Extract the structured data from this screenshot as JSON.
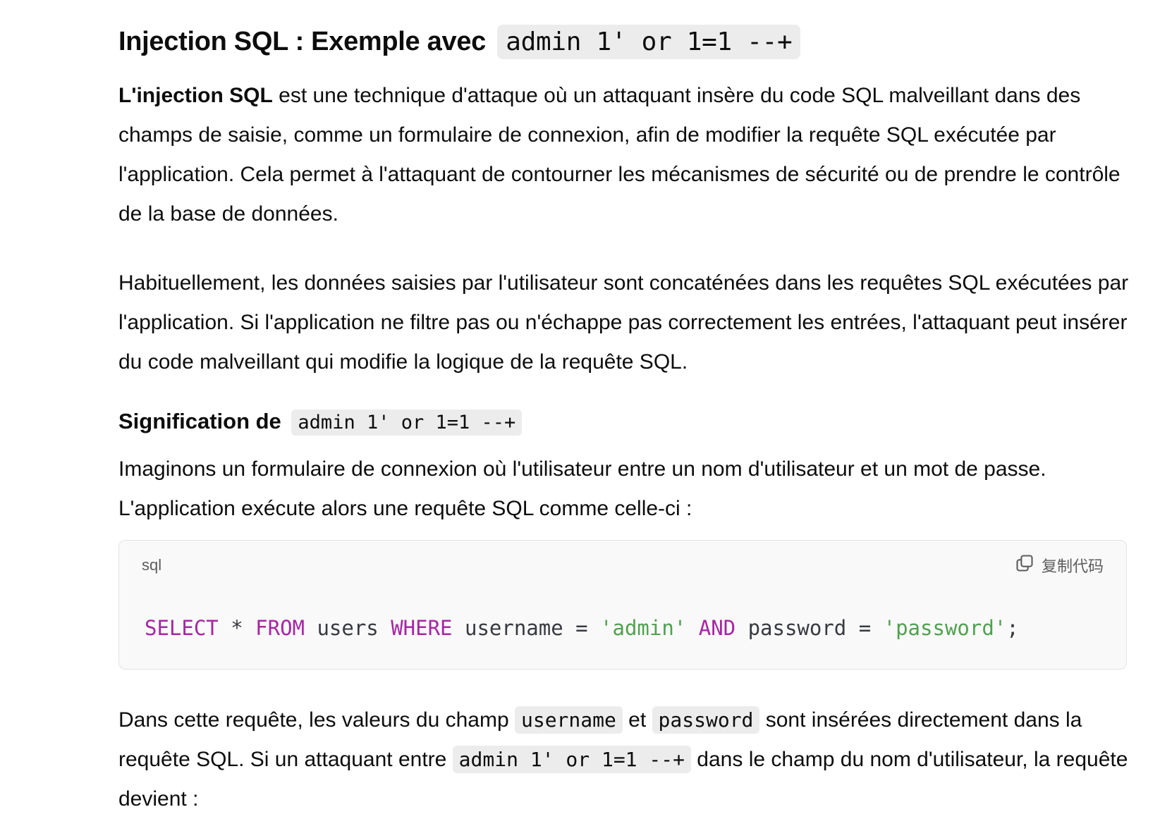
{
  "heading": {
    "title_text": "Injection SQL : Exemple avec",
    "title_code": "admin 1' or 1=1 --+"
  },
  "intro": {
    "bold_term": "L'injection SQL",
    "text": " est une technique d'attaque où un attaquant insère du code SQL malveillant dans des champs de saisie, comme un formulaire de connexion, afin de modifier la requête SQL exécutée par l'application. Cela permet à l'attaquant de contourner les mécanismes de sécurité ou de prendre le contrôle de la base de données."
  },
  "paragraph2": "Habituellement, les données saisies par l'utilisateur sont concaténées dans les requêtes SQL exécutées par l'application. Si l'application ne filtre pas ou n'échappe pas correctement les entrées, l'attaquant peut insérer du code malveillant qui modifie la logique de la requête SQL.",
  "subheading": {
    "text": "Signification de",
    "code": "admin 1' or 1=1 --+"
  },
  "paragraph3": "Imaginons un formulaire de connexion où l'utilisateur entre un nom d'utilisateur et un mot de passe. L'application exécute alors une requête SQL comme celle-ci :",
  "code_block": {
    "language": "sql",
    "copy_label": "复制代码",
    "copy_icon": "copy-icon",
    "tokens": {
      "t1": "SELECT",
      "t2": " * ",
      "t3": "FROM",
      "t4": " users ",
      "t5": "WHERE",
      "t6": " username = ",
      "t7": "'admin'",
      "t8": " ",
      "t9": "AND",
      "t10": " password = ",
      "t11": "'password'",
      "t12": ";"
    },
    "colors": {
      "keyword": "#a626a4",
      "string": "#50a14f",
      "plain": "#383a42"
    }
  },
  "paragraph4": {
    "part1": "Dans cette requête, les valeurs du champ ",
    "code1": "username",
    "part2": " et ",
    "code2": "password",
    "part3": " sont insérées directement dans la requête SQL. Si un attaquant entre ",
    "code3": "admin 1' or 1=1 --+",
    "part4": " dans le champ du nom d'utilisateur, la requête devient :"
  }
}
